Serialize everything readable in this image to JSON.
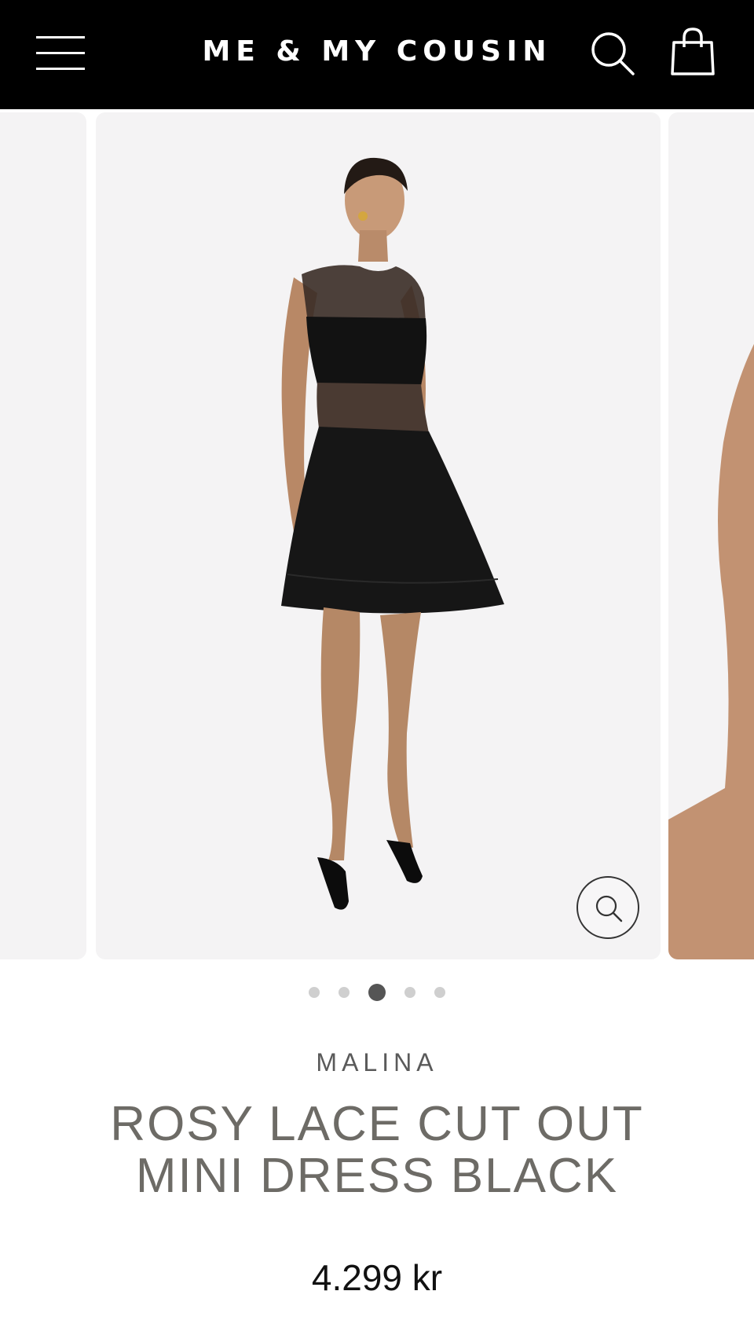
{
  "header": {
    "logo_text": "ME & MY COUSIN",
    "menu_icon": "hamburger-menu-icon",
    "search_icon": "search-icon",
    "cart_icon": "shopping-bag-icon",
    "background": "#000000"
  },
  "gallery": {
    "zoom_icon": "zoom-icon",
    "slide_count": 5,
    "active_slide": 3
  },
  "product": {
    "brand": "MALINA",
    "title": "ROSY LACE CUT OUT MINI DRESS BLACK",
    "price": "4.299 kr"
  },
  "colors": {
    "header_bg": "#000000",
    "slide_bg": "#f4f3f4",
    "title_text": "#6d6b66",
    "dot_active": "#555555",
    "dot_inactive": "#cfcfcf"
  }
}
